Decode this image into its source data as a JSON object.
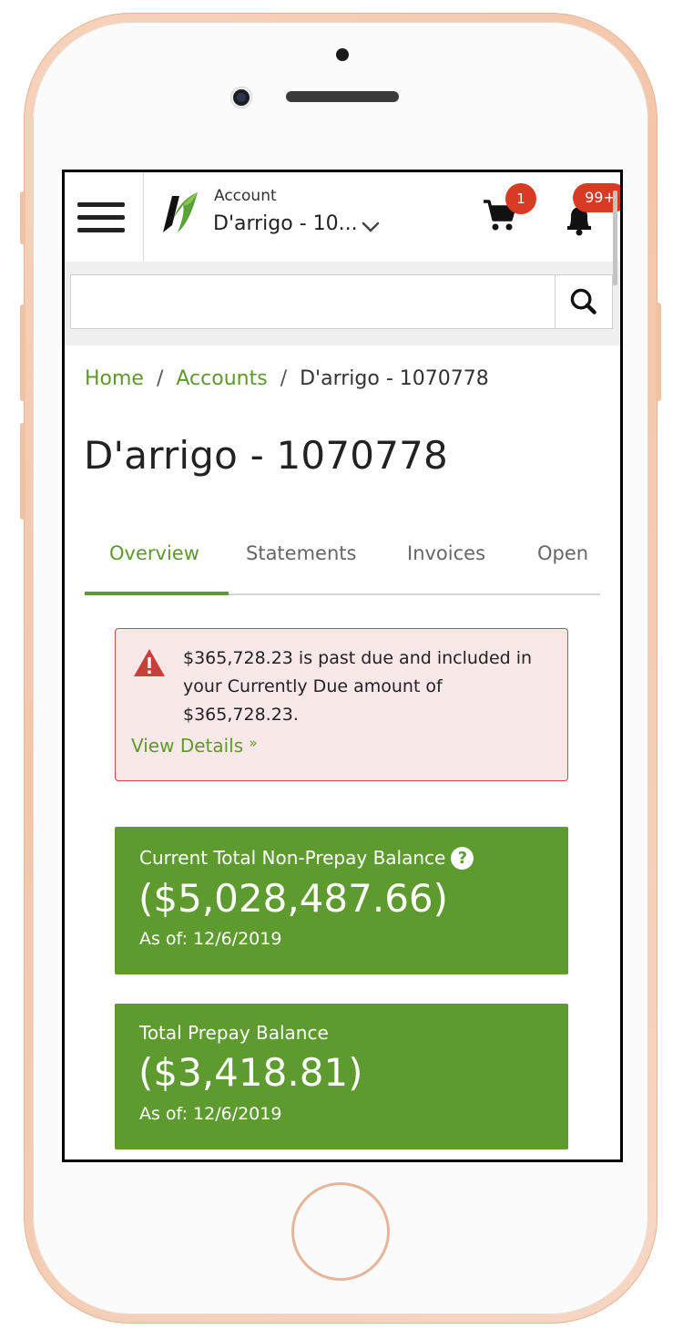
{
  "header": {
    "account_label": "Account",
    "account_name": "D'arrigo - 10...",
    "cart_badge": "1",
    "notifications_badge": "99+"
  },
  "search": {
    "placeholder": ""
  },
  "breadcrumb": {
    "home": "Home",
    "separator": "/",
    "accounts": "Accounts",
    "current": "D'arrigo - 1070778"
  },
  "page": {
    "title": "D'arrigo - 1070778"
  },
  "tabs": [
    {
      "label": "Overview",
      "active": true
    },
    {
      "label": "Statements",
      "active": false
    },
    {
      "label": "Invoices",
      "active": false
    },
    {
      "label": "Open",
      "active": false
    }
  ],
  "alert": {
    "message": "$365,728.23 is past due and included in your Currently Due amount of $365,728.23.",
    "link_label": "View Details",
    "link_suffix": "»"
  },
  "balances": [
    {
      "label": "Current Total Non-Prepay Balance",
      "value": "($5,028,487.66)",
      "as_of": "As of: 12/6/2019",
      "has_help": true
    },
    {
      "label": "Total Prepay Balance",
      "value": "($3,418.81)",
      "as_of": "As of: 12/6/2019",
      "has_help": false
    }
  ],
  "colors": {
    "brand_green": "#5e9b2f",
    "link_green": "#5d992b",
    "alert_red": "#d14747",
    "badge_red": "#d93a24"
  },
  "icons": {
    "menu": "hamburger-icon",
    "logo": "n-leaf-logo",
    "dropdown": "chevron-down-icon",
    "cart": "cart-icon",
    "bell": "bell-icon",
    "search": "search-icon",
    "warning": "warning-triangle-icon",
    "help": "question-circle-icon"
  }
}
